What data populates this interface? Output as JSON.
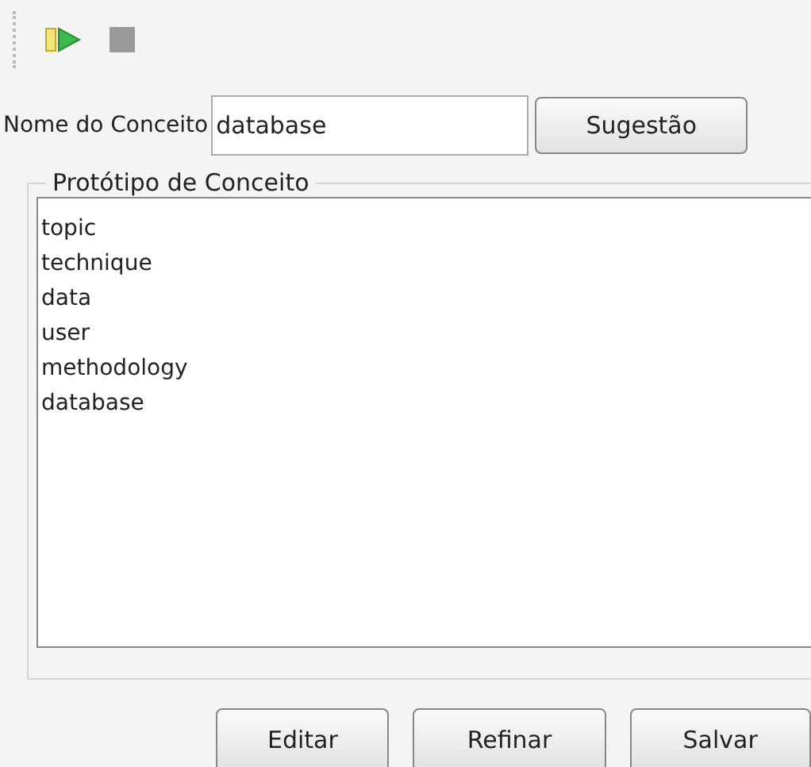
{
  "toolbar": {
    "buttons": [
      {
        "kind": "run"
      },
      {
        "kind": "stop"
      }
    ]
  },
  "concept": {
    "label": "Nome do Conceito",
    "value": "database",
    "button": "Sugestão"
  },
  "prototype": {
    "title": "Protótipo de Conceito",
    "items": [
      "topic",
      "technique",
      "data",
      "user",
      "methodology",
      "database"
    ]
  },
  "buttons": [
    "Editar",
    "Refinar",
    "Salvar"
  ]
}
